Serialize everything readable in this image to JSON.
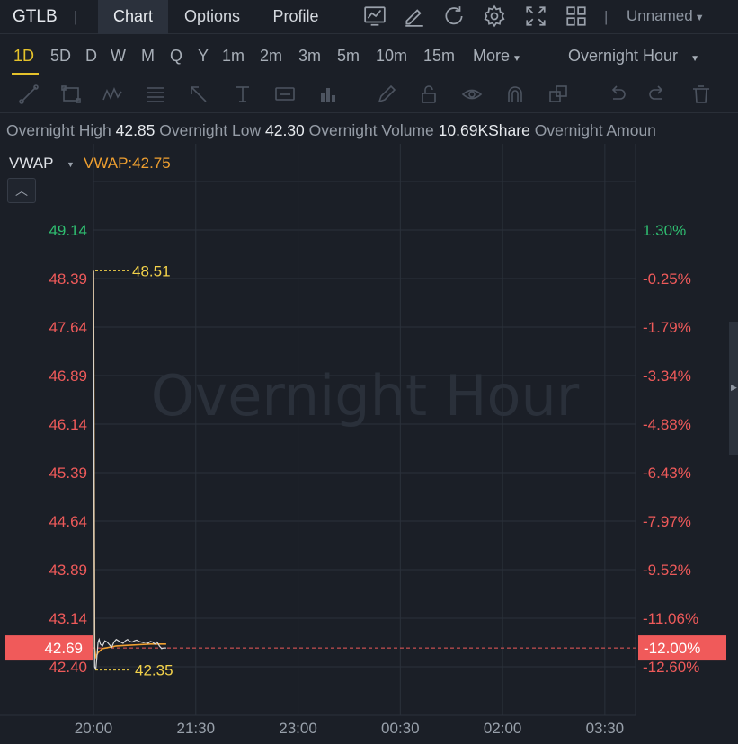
{
  "header": {
    "ticker": "GTLB",
    "separator": "|",
    "tabs": [
      {
        "label": "Chart",
        "active": true
      },
      {
        "label": "Options",
        "active": false
      },
      {
        "label": "Profile",
        "active": false
      }
    ],
    "icons": [
      "line-chart-icon",
      "edit-icon",
      "refresh-icon",
      "gear-icon",
      "fullscreen-icon",
      "grid-layout-icon"
    ],
    "layout_name": "Unnamed"
  },
  "periods": {
    "items": [
      "1D",
      "5D",
      "D",
      "W",
      "M",
      "Q",
      "Y",
      "1m",
      "2m",
      "3m",
      "5m",
      "10m",
      "15m"
    ],
    "more_label": "More",
    "active": "1D",
    "session": "Overnight Hour"
  },
  "draw_tools": [
    "trend-line-icon",
    "rectangle-icon",
    "pattern-icon",
    "fib-icon",
    "arrow-icon",
    "text-icon",
    "label-icon",
    "bar-icon",
    "pen-icon",
    "lock-icon",
    "eye-icon",
    "magnet-icon",
    "layers-icon",
    "undo-icon",
    "redo-icon",
    "trash-icon"
  ],
  "stats": [
    {
      "label": "Overnight High",
      "value": "42.85"
    },
    {
      "label": "Overnight Low",
      "value": "42.30"
    },
    {
      "label": "Overnight Volume",
      "value": "10.69KShare"
    },
    {
      "label": "Overnight Amoun",
      "value": ""
    }
  ],
  "indicator": {
    "name": "VWAP",
    "value_text": "VWAP:42.75",
    "color": "#f0a030"
  },
  "chart_data": {
    "type": "line",
    "watermark": "Overnight Hour",
    "x_ticks": [
      "20:00",
      "21:30",
      "23:00",
      "00:30",
      "02:00",
      "03:30"
    ],
    "y_ticks_left": [
      "49.14",
      "48.39",
      "47.64",
      "46.89",
      "46.14",
      "45.39",
      "44.64",
      "43.89",
      "43.14",
      "42.40"
    ],
    "y_ticks_right": [
      "1.30%",
      "-0.25%",
      "-1.79%",
      "-3.34%",
      "-4.88%",
      "-6.43%",
      "-7.97%",
      "-9.52%",
      "-11.06%",
      "-12.60%"
    ],
    "ylim": [
      42.4,
      49.14
    ],
    "prev_close_pct_zero": 48.51,
    "current_price": "42.69",
    "current_pct": "-12.00%",
    "current_value": 42.69,
    "high_annotation": {
      "label": "48.51",
      "value": 48.51
    },
    "low_annotation": {
      "label": "42.35",
      "value": 42.35
    },
    "price_series": {
      "name": "Price",
      "minutes": [
        0,
        1,
        2,
        3,
        4,
        5,
        6,
        8,
        10,
        12,
        14,
        16,
        18,
        20,
        22,
        24,
        26,
        28,
        30,
        32,
        34,
        36,
        38,
        40,
        42,
        44,
        46,
        48,
        50,
        52,
        54,
        56,
        58,
        60,
        62,
        64
      ],
      "values": [
        48.51,
        42.4,
        42.35,
        42.55,
        42.78,
        42.82,
        42.75,
        42.72,
        42.8,
        42.78,
        42.74,
        42.7,
        42.78,
        42.82,
        42.8,
        42.78,
        42.76,
        42.8,
        42.82,
        42.79,
        42.78,
        42.8,
        42.81,
        42.79,
        42.78,
        42.77,
        42.78,
        42.76,
        42.79,
        42.78,
        42.75,
        42.78,
        42.72,
        42.68,
        42.69,
        42.69
      ],
      "color": "#d8d8d8"
    },
    "vwap_series": {
      "name": "VWAP",
      "minutes": [
        0,
        1,
        2,
        4,
        8,
        14,
        20,
        30,
        40,
        50,
        60,
        64
      ],
      "values": [
        48.51,
        42.7,
        42.55,
        42.62,
        42.68,
        42.7,
        42.72,
        42.73,
        42.74,
        42.75,
        42.75,
        42.75
      ],
      "color": "#f0a030"
    },
    "colors": {
      "up": "#2fbf71",
      "down": "#ef5a5a",
      "tag": "#f05a5a",
      "annotation": "#f2d14a"
    }
  }
}
